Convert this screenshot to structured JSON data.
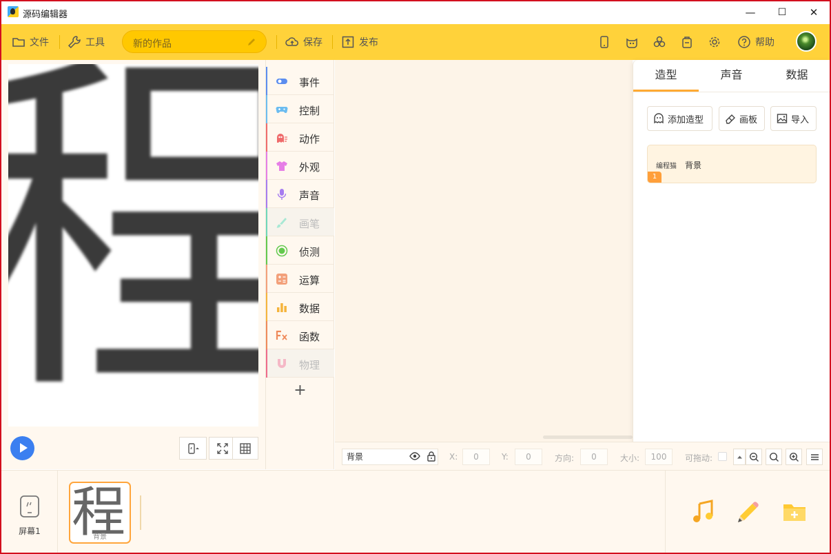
{
  "window": {
    "title": "源码编辑器",
    "minimize": "—",
    "maximize": "☐",
    "close": "✕"
  },
  "toolbar": {
    "file": "文件",
    "tools": "工具",
    "project_name": "新的作品",
    "save": "保存",
    "publish": "发布",
    "help": "帮助"
  },
  "categories": [
    {
      "label": "事件",
      "color": "#5b8def",
      "icon": "toggle-icon",
      "disabled": false
    },
    {
      "label": "控制",
      "color": "#6bbcf0",
      "icon": "gamepad-icon",
      "disabled": false
    },
    {
      "label": "动作",
      "color": "#ef6b6b",
      "icon": "ghost-icon",
      "disabled": false
    },
    {
      "label": "外观",
      "color": "#e67ee6",
      "icon": "shirt-icon",
      "disabled": false
    },
    {
      "label": "声音",
      "color": "#a67cf0",
      "icon": "microphone-icon",
      "disabled": false
    },
    {
      "label": "画笔",
      "color": "#6fd8b8",
      "icon": "brush-icon",
      "disabled": true
    },
    {
      "label": "侦测",
      "color": "#63c94e",
      "icon": "detect-icon",
      "disabled": false
    },
    {
      "label": "运算",
      "color": "#f3a07a",
      "icon": "calculator-icon",
      "disabled": false
    },
    {
      "label": "数据",
      "color": "#f5b43c",
      "icon": "bar-chart-icon",
      "disabled": false
    },
    {
      "label": "函数",
      "color": "#ef8a5a",
      "icon": "function-icon",
      "disabled": false
    },
    {
      "label": "物理",
      "color": "#ef6b8a",
      "icon": "magnet-icon",
      "disabled": true
    }
  ],
  "stage": {
    "char": "程"
  },
  "panel": {
    "tabs": [
      "造型",
      "声音",
      "数据"
    ],
    "active_tab": 0,
    "buttons": {
      "add": "添加造型",
      "paint": "画板",
      "import": "导入"
    },
    "costume": {
      "source": "编程猫",
      "name": "背景",
      "index": "1"
    }
  },
  "props": {
    "sprite": "背景",
    "x_label": "X:",
    "x": "0",
    "y_label": "Y:",
    "y": "0",
    "dir_label": "方向:",
    "dir": "0",
    "size_label": "大小:",
    "size": "100",
    "drag_label": "可拖动:"
  },
  "bottom": {
    "screen_label": "屏幕1",
    "thumb_char": "程",
    "thumb_caption": "背景"
  },
  "colors": {
    "toolbar": "#ffd23a",
    "accent": "#ffa53b",
    "play": "#3b7ff0"
  }
}
